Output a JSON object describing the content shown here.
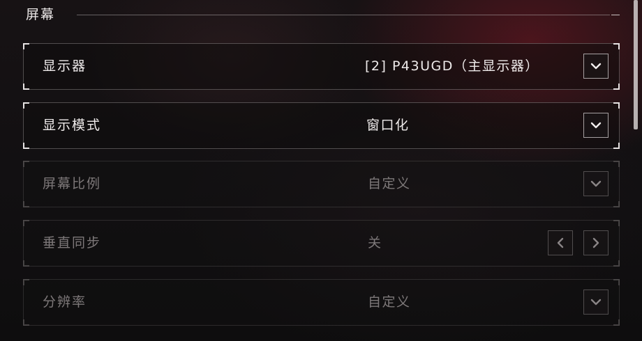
{
  "section": {
    "title": "屏幕"
  },
  "settings": [
    {
      "label": "显示器",
      "value": "[2]  P43UGD（主显示器）",
      "control": "dropdown",
      "enabled": true
    },
    {
      "label": "显示模式",
      "value": "窗口化",
      "control": "dropdown",
      "enabled": true
    },
    {
      "label": "屏幕比例",
      "value": "自定义",
      "control": "dropdown",
      "enabled": false
    },
    {
      "label": "垂直同步",
      "value": "关",
      "control": "toggle-arrows",
      "enabled": false
    },
    {
      "label": "分辨率",
      "value": "自定义",
      "control": "dropdown",
      "enabled": false
    }
  ],
  "icons": {
    "dropdown": "chevron-down-icon",
    "prev": "chevron-left-icon",
    "next": "chevron-right-icon"
  },
  "colors": {
    "accent_background": "#7a1824",
    "text_primary": "#efebeb",
    "text_disabled": "#7d7879"
  }
}
